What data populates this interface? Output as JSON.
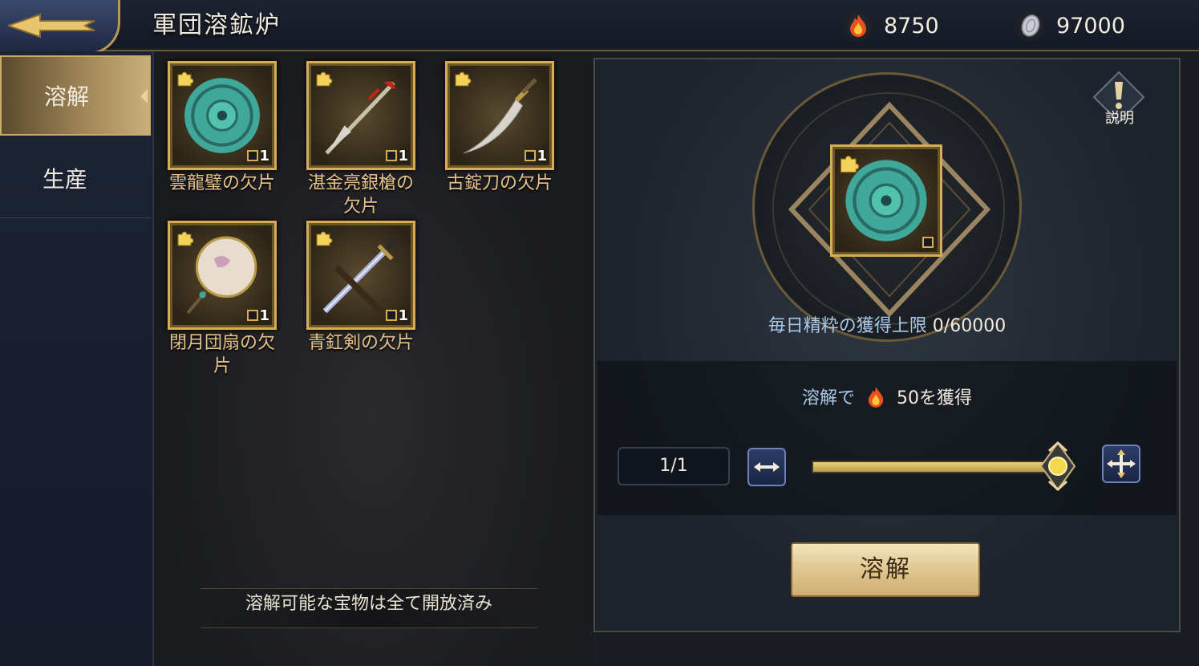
{
  "header": {
    "title": "軍団溶鉱炉",
    "back_icon": "back-arrow-icon",
    "currencies": [
      {
        "icon": "fire-essence-icon",
        "value": "8750"
      },
      {
        "icon": "silver-coin-icon",
        "value": "97000"
      }
    ]
  },
  "sidebar": {
    "items": [
      {
        "label": "溶解",
        "active": true
      },
      {
        "label": "生産",
        "active": false
      }
    ]
  },
  "items": [
    {
      "name": "雲龍璧の欠片",
      "qty": "1",
      "icon": "jade-disc-fragment-icon"
    },
    {
      "name": "湛金亮銀槍の欠片",
      "qty": "1",
      "icon": "spear-fragment-icon"
    },
    {
      "name": "古錠刀の欠片",
      "qty": "1",
      "icon": "saber-fragment-icon"
    },
    {
      "name": "閉月団扇の欠片",
      "qty": "1",
      "icon": "round-fan-fragment-icon"
    },
    {
      "name": "青釭剣の欠片",
      "qty": "1",
      "icon": "sword-fragment-icon"
    }
  ],
  "notice": "溶解可能な宝物は全て開放済み",
  "panel": {
    "help_label": "説明",
    "daily_label": "毎日精粋の獲得上限",
    "daily_value": "0/60000",
    "gain_prefix": "溶解で",
    "gain_value": "50を獲得",
    "count": "1/1",
    "slider_level": 1.0,
    "dissolve_button": "溶解"
  },
  "colors": {
    "gold": "#d6ad55",
    "label_blue": "#a9c8e8",
    "item_name": "#e8c48a"
  }
}
